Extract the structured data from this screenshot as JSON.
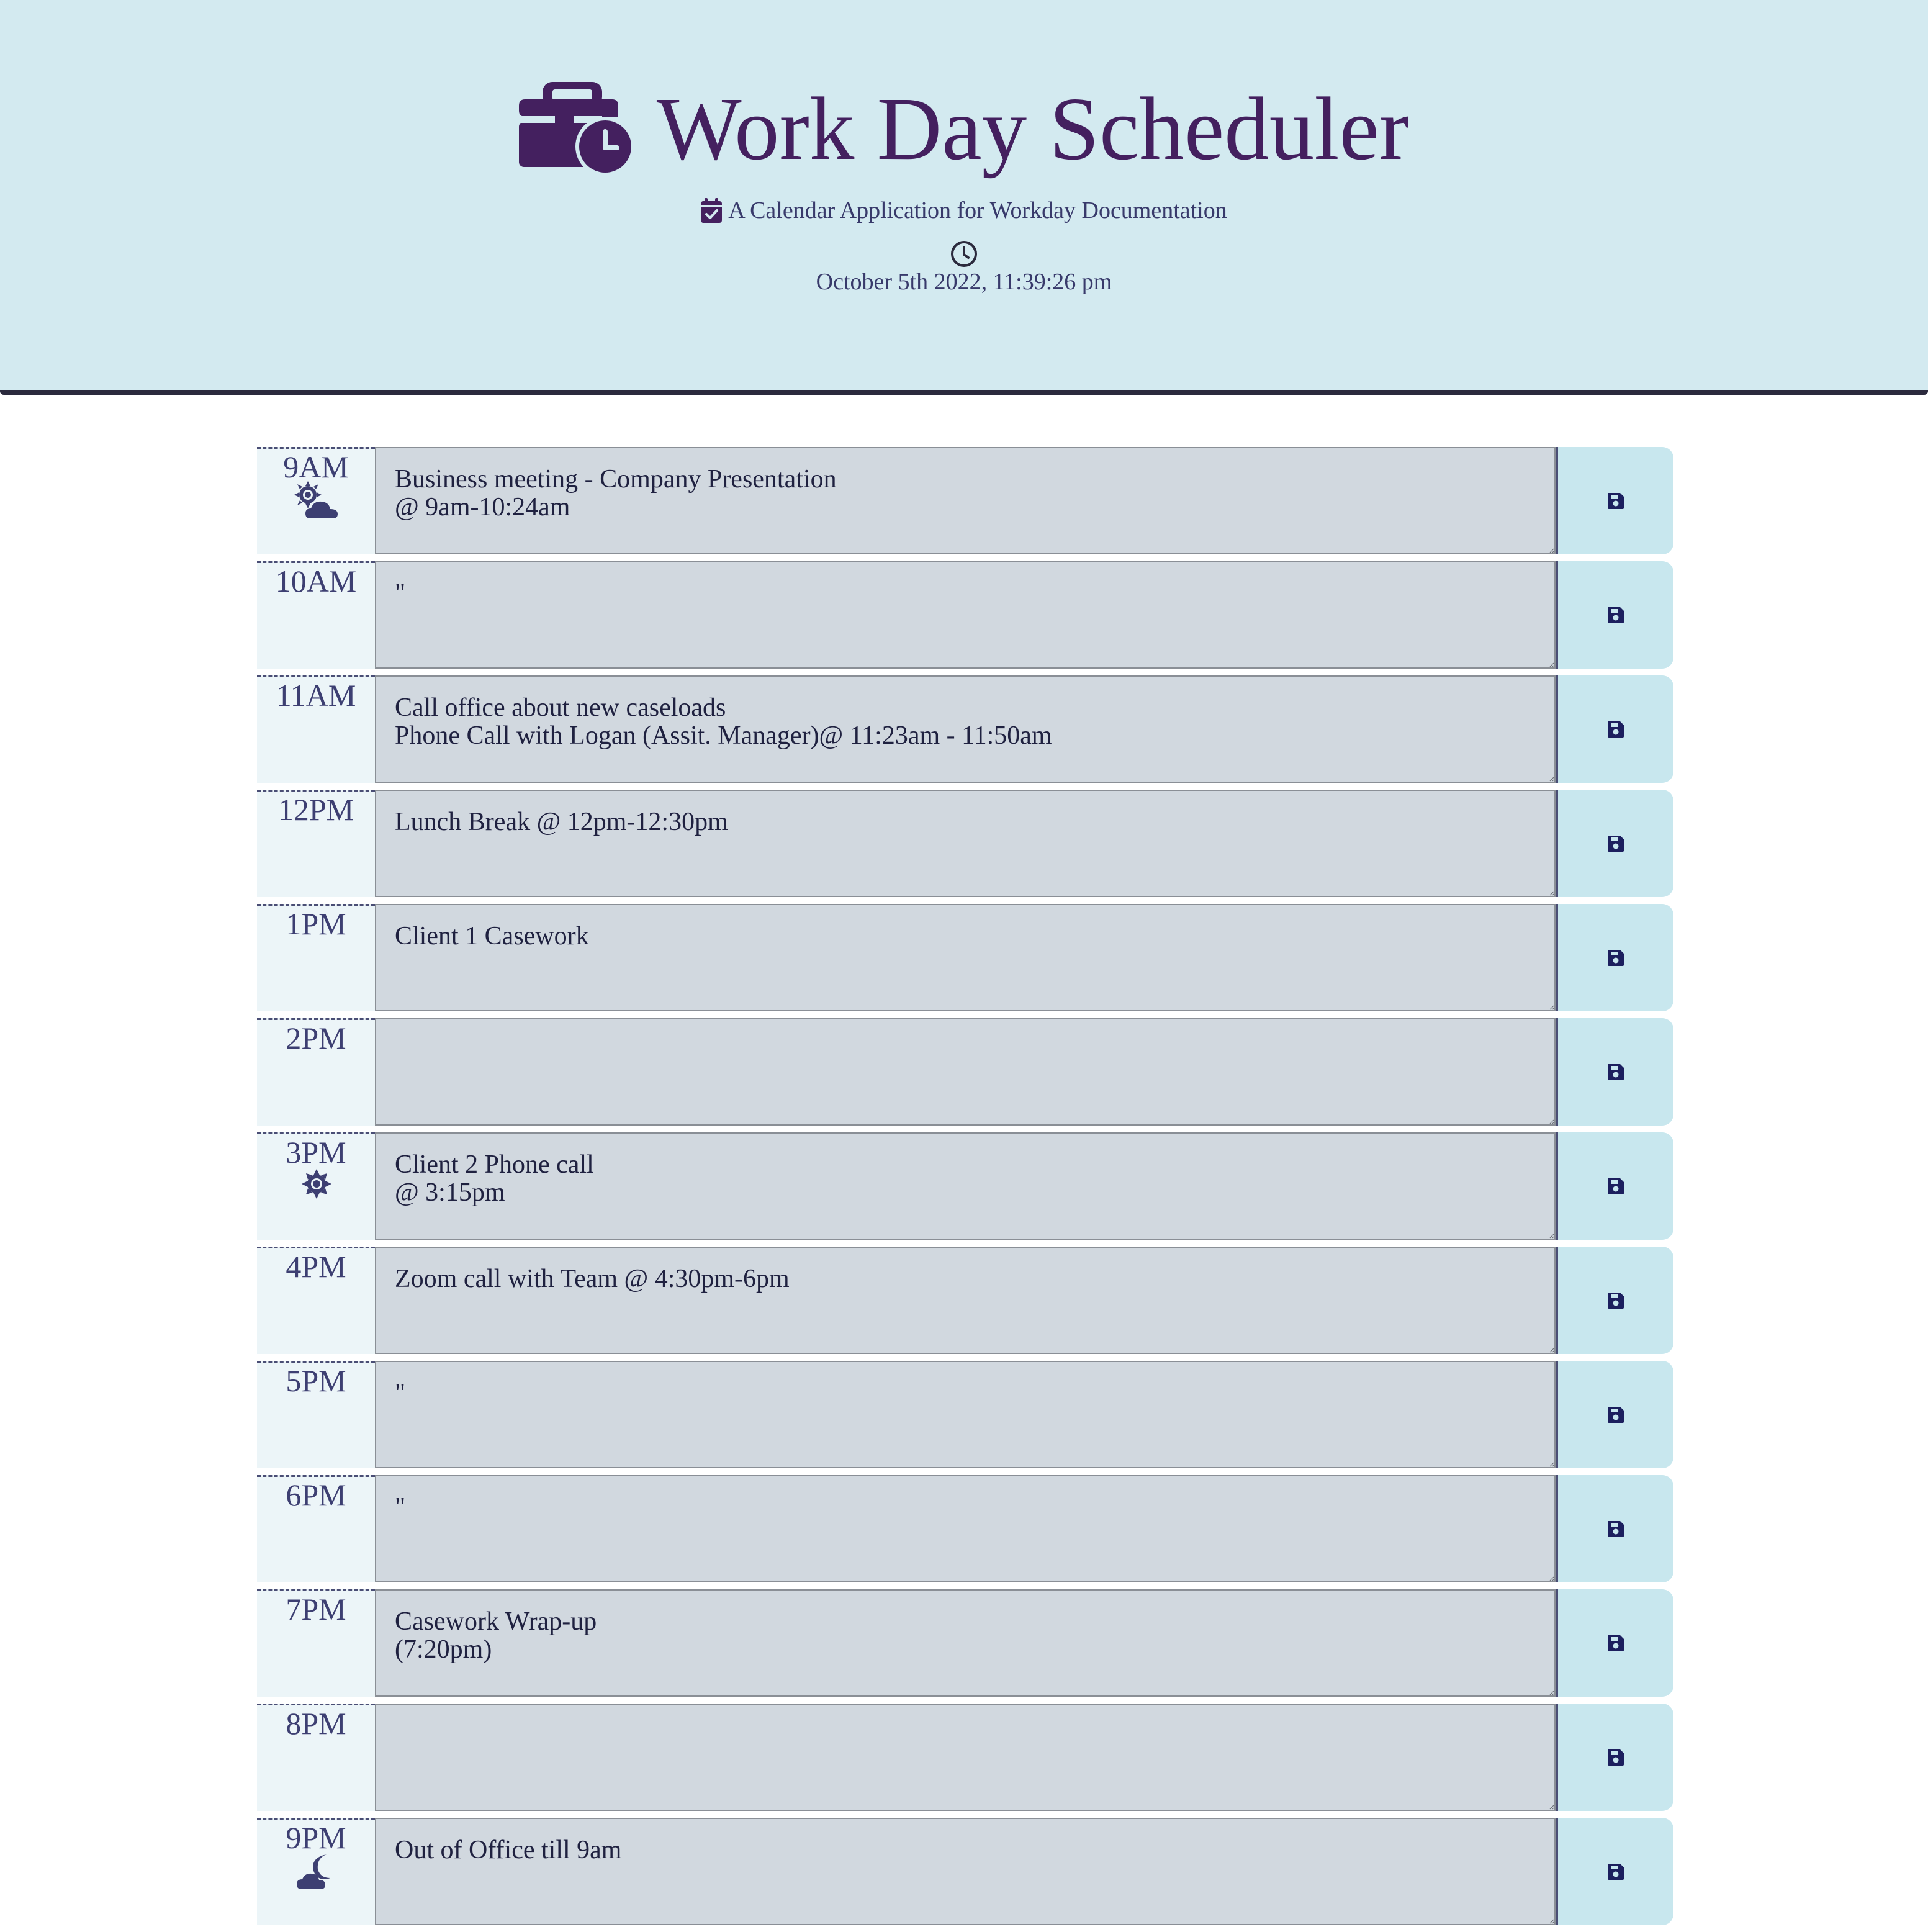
{
  "header": {
    "title": "Work Day Scheduler",
    "title_icon": "briefcase-clock-icon",
    "subtitle": "A Calendar Application for Workday Documentation",
    "subtitle_icon": "calendar-check-icon",
    "datetime_icon": "clock-icon",
    "datetime": "October 5th 2022, 11:39:26 pm"
  },
  "colors": {
    "header_bg": "#d3eaf0",
    "title": "#44205f",
    "text": "#383a6b",
    "hour_bg": "#ecf5f8",
    "textarea_bg": "#d1d8df",
    "save_bg": "#c8e7ee",
    "save_icon": "#1c1f5e"
  },
  "rows": [
    {
      "hour": "9AM",
      "icon": "sun-cloud-icon",
      "text": "Business meeting - Company Presentation\n@ 9am-10:24am"
    },
    {
      "hour": "10AM",
      "icon": "",
      "text": "\""
    },
    {
      "hour": "11AM",
      "icon": "",
      "text": "Call office about new caseloads\nPhone Call with Logan (Assit. Manager)@ 11:23am - 11:50am"
    },
    {
      "hour": "12PM",
      "icon": "",
      "text": "Lunch Break @ 12pm-12:30pm"
    },
    {
      "hour": "1PM",
      "icon": "",
      "text": "Client 1 Casework"
    },
    {
      "hour": "2PM",
      "icon": "",
      "text": ""
    },
    {
      "hour": "3PM",
      "icon": "sun-icon",
      "text": "Client 2 Phone call\n@ 3:15pm"
    },
    {
      "hour": "4PM",
      "icon": "",
      "text": "Zoom call with Team @ 4:30pm-6pm"
    },
    {
      "hour": "5PM",
      "icon": "",
      "text": "\""
    },
    {
      "hour": "6PM",
      "icon": "",
      "text": "\""
    },
    {
      "hour": "7PM",
      "icon": "",
      "text": "Casework Wrap-up\n(7:20pm)"
    },
    {
      "hour": "8PM",
      "icon": "",
      "text": ""
    },
    {
      "hour": "9PM",
      "icon": "moon-cloud-icon",
      "text": "Out of Office till 9am"
    }
  ],
  "save_icon": "save-icon"
}
